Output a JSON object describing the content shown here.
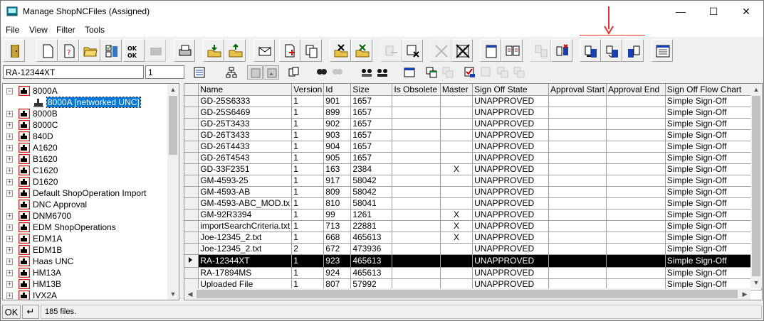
{
  "window": {
    "title": "Manage ShopNCFiles (Assigned)"
  },
  "menu": [
    "File",
    "View",
    "Filter",
    "Tools"
  ],
  "search": {
    "value": "RA-12344XT",
    "revision": "1"
  },
  "tree": {
    "items": [
      {
        "label": "8000A",
        "expander": "−",
        "level": 0
      },
      {
        "label": "8000A [networked UNC]",
        "expander": "",
        "level": 1,
        "selected": true
      },
      {
        "label": "8000B",
        "expander": "+",
        "level": 0
      },
      {
        "label": "8000C",
        "expander": "+",
        "level": 0
      },
      {
        "label": "840D",
        "expander": "+",
        "level": 0
      },
      {
        "label": "A1620",
        "expander": "+",
        "level": 0
      },
      {
        "label": "B1620",
        "expander": "+",
        "level": 0
      },
      {
        "label": "C1620",
        "expander": "+",
        "level": 0
      },
      {
        "label": "D1620",
        "expander": "+",
        "level": 0
      },
      {
        "label": "Default ShopOperation Import",
        "expander": "+",
        "level": 0
      },
      {
        "label": "DNC Approval",
        "expander": "",
        "level": 0
      },
      {
        "label": "DNM6700",
        "expander": "+",
        "level": 0
      },
      {
        "label": "EDM ShopOperations",
        "expander": "+",
        "level": 0
      },
      {
        "label": "EDM1A",
        "expander": "+",
        "level": 0
      },
      {
        "label": "EDM1B",
        "expander": "+",
        "level": 0
      },
      {
        "label": "Haas UNC",
        "expander": "+",
        "level": 0
      },
      {
        "label": "HM13A",
        "expander": "+",
        "level": 0
      },
      {
        "label": "HM13B",
        "expander": "+",
        "level": 0
      },
      {
        "label": "IVX2A",
        "expander": "+",
        "level": 0
      }
    ]
  },
  "grid": {
    "columns": [
      "Name",
      "Version",
      "Id",
      "Size",
      "Is Obsolete",
      "Master",
      "Sign Off State",
      "Approval Start",
      "Approval End",
      "Sign Off Flow Chart"
    ],
    "rows": [
      [
        "GD-25S6333",
        "1",
        "901",
        "1657",
        "",
        "",
        "UNAPPROVED",
        "",
        "",
        "Simple Sign-Off"
      ],
      [
        "GD-25S6469",
        "1",
        "899",
        "1657",
        "",
        "",
        "UNAPPROVED",
        "",
        "",
        "Simple Sign-Off"
      ],
      [
        "GD-25T3433",
        "1",
        "902",
        "1657",
        "",
        "",
        "UNAPPROVED",
        "",
        "",
        "Simple Sign-Off"
      ],
      [
        "GD-26T3433",
        "1",
        "903",
        "1657",
        "",
        "",
        "UNAPPROVED",
        "",
        "",
        "Simple Sign-Off"
      ],
      [
        "GD-26T4433",
        "1",
        "904",
        "1657",
        "",
        "",
        "UNAPPROVED",
        "",
        "",
        "Simple Sign-Off"
      ],
      [
        "GD-26T4543",
        "1",
        "905",
        "1657",
        "",
        "",
        "UNAPPROVED",
        "",
        "",
        "Simple Sign-Off"
      ],
      [
        "GD-33F2351",
        "1",
        "163",
        "2384",
        "",
        "X",
        "UNAPPROVED",
        "",
        "",
        "Simple Sign-Off"
      ],
      [
        "GM-4593-25",
        "1",
        "917",
        "58042",
        "",
        "",
        "UNAPPROVED",
        "",
        "",
        "Simple Sign-Off"
      ],
      [
        "GM-4593-AB",
        "1",
        "809",
        "58042",
        "",
        "",
        "UNAPPROVED",
        "",
        "",
        "Simple Sign-Off"
      ],
      [
        "GM-4593-ABC_MOD.tx",
        "1",
        "810",
        "58041",
        "",
        "",
        "UNAPPROVED",
        "",
        "",
        "Simple Sign-Off"
      ],
      [
        "GM-92R3394",
        "1",
        "99",
        "1261",
        "",
        "X",
        "UNAPPROVED",
        "",
        "",
        "Simple Sign-Off"
      ],
      [
        "importSearchCriteria.txt",
        "1",
        "713",
        "22881",
        "",
        "X",
        "UNAPPROVED",
        "",
        "",
        "Simple Sign-Off"
      ],
      [
        "Joe-12345_2.txt",
        "1",
        "668",
        "465613",
        "",
        "X",
        "UNAPPROVED",
        "",
        "",
        "Simple Sign-Off"
      ],
      [
        "Joe-12345_2.txt",
        "2",
        "672",
        "473936",
        "",
        "",
        "UNAPPROVED",
        "",
        "",
        "Simple Sign-Off"
      ],
      [
        "RA-12344XT",
        "1",
        "923",
        "465613",
        "",
        "",
        "UNAPPROVED",
        "",
        "",
        "Simple Sign-Off"
      ],
      [
        "RA-17894MS",
        "1",
        "924",
        "465613",
        "",
        "",
        "UNAPPROVED",
        "",
        "",
        "Simple Sign-Off"
      ],
      [
        "Uploaded File",
        "1",
        "807",
        "57992",
        "",
        "",
        "UNAPPROVED",
        "",
        "",
        "Simple Sign-Off"
      ]
    ],
    "selected_row": 14
  },
  "status": {
    "ok_label": "OK",
    "enter_label": "↵",
    "text": "185 files."
  },
  "colors": {
    "selection": "#0078d7",
    "annotation_arrow": "#e03030",
    "selected_row": "#000000"
  }
}
